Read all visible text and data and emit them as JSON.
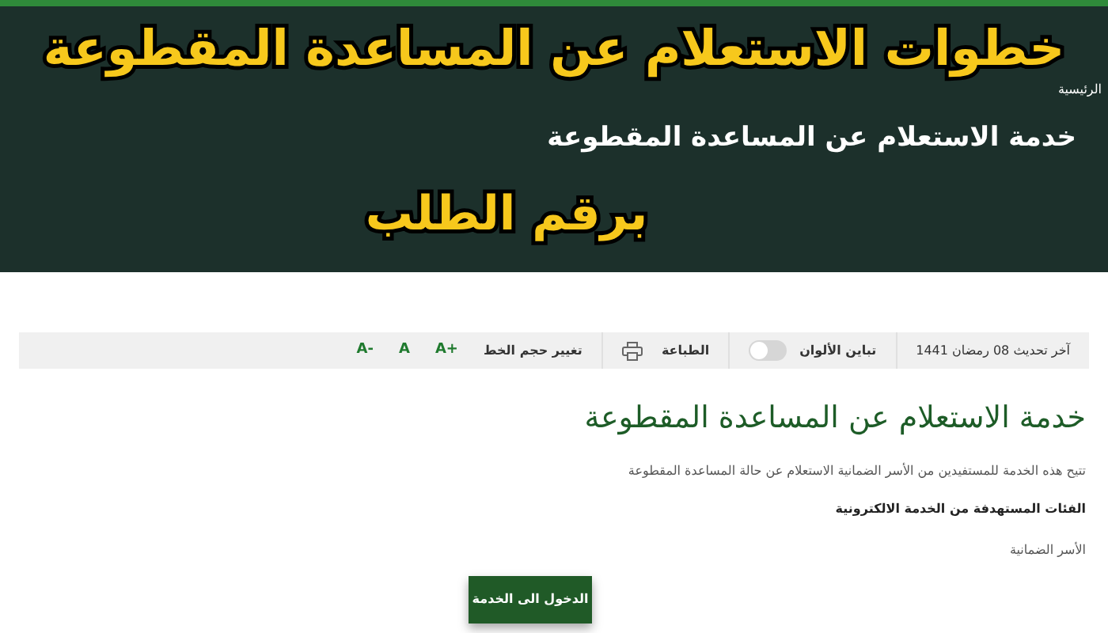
{
  "caption": {
    "title": "خطوات الاستعلام عن المساعدة المقطوعة",
    "subtitle": "برقم الطلب"
  },
  "breadcrumb": "الرئيسية",
  "page_title": "خدمة الاستعلام عن المساعدة المقطوعة",
  "toolbar": {
    "last_updated": "آخر تحديث 08 رمضان 1441",
    "contrast": {
      "label": "تباين الألوان",
      "on": false
    },
    "print": "الطباعة",
    "font_size": {
      "label": "تغيير حجم الخط",
      "buttons": [
        "A+",
        "A",
        "A-"
      ]
    }
  },
  "content": {
    "heading": "خدمة الاستعلام عن المساعدة المقطوعة",
    "description": "تتيح هذه الخدمة للمستفيدين من الأسر الضمانية الاستعلام عن حالة المساعدة المقطوعة",
    "target_label": "الفئات المستهدفة من الخدمة الالكترونية",
    "target_value": "الأسر الضمانية",
    "button": "الدخول الى الخدمة"
  }
}
